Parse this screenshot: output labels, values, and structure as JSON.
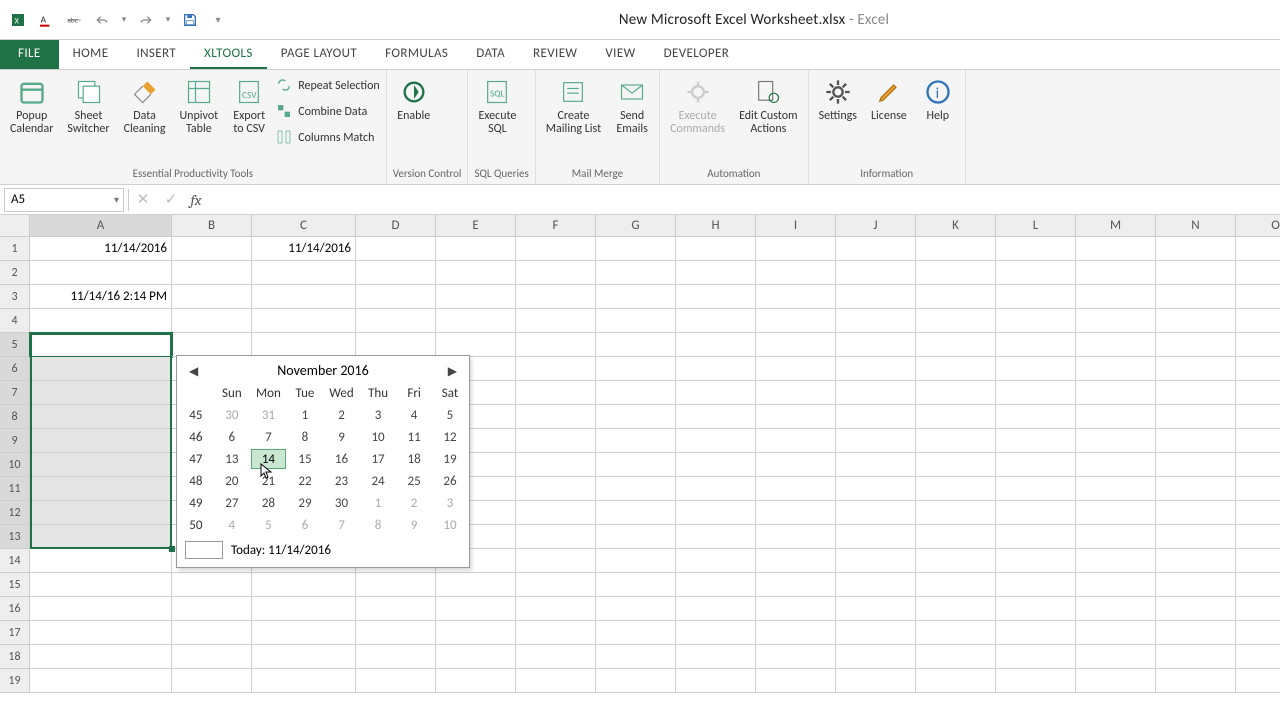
{
  "title": {
    "doc": "New Microsoft Excel Worksheet.xlsx",
    "app": "Excel"
  },
  "tabs": [
    "FILE",
    "HOME",
    "INSERT",
    "XLTools",
    "PAGE LAYOUT",
    "FORMULAS",
    "DATA",
    "REVIEW",
    "VIEW",
    "DEVELOPER"
  ],
  "activeTab": "XLTools",
  "ribbon": {
    "groups": [
      {
        "label": "Essential Productivity Tools",
        "big": [
          {
            "name": "popup-calendar-button",
            "label": "Popup\nCalendar",
            "icon": "calendar"
          },
          {
            "name": "sheet-switcher-button",
            "label": "Sheet\nSwitcher",
            "icon": "sheets"
          },
          {
            "name": "data-cleaning-button",
            "label": "Data\nCleaning",
            "icon": "broom"
          },
          {
            "name": "unpivot-table-button",
            "label": "Unpivot\nTable",
            "icon": "table"
          },
          {
            "name": "export-csv-button",
            "label": "Export\nto CSV",
            "icon": "csv"
          }
        ],
        "small": [
          {
            "name": "repeat-selection-button",
            "label": "Repeat Selection",
            "icon": "repeat"
          },
          {
            "name": "combine-data-button",
            "label": "Combine Data",
            "icon": "combine"
          },
          {
            "name": "columns-match-button",
            "label": "Columns Match",
            "icon": "match"
          }
        ]
      },
      {
        "label": "Version Control",
        "big": [
          {
            "name": "enable-button",
            "label": "Enable",
            "icon": "version"
          }
        ],
        "small": []
      },
      {
        "label": "SQL Queries",
        "big": [
          {
            "name": "execute-sql-button",
            "label": "Execute\nSQL",
            "icon": "sql"
          }
        ],
        "small": []
      },
      {
        "label": "Mail Merge",
        "big": [
          {
            "name": "create-mailing-list-button",
            "label": "Create\nMailing List",
            "icon": "list"
          },
          {
            "name": "send-emails-button",
            "label": "Send\nEmails",
            "icon": "mail"
          }
        ],
        "small": []
      },
      {
        "label": "Automation",
        "big": [
          {
            "name": "execute-commands-button",
            "label": "Execute\nCommands",
            "icon": "gear",
            "disabled": true
          },
          {
            "name": "edit-custom-actions-button",
            "label": "Edit Custom\nActions",
            "icon": "geardoc"
          }
        ],
        "small": []
      },
      {
        "label": "Information",
        "big": [
          {
            "name": "settings-button",
            "label": "Settings",
            "icon": "cog"
          },
          {
            "name": "license-button",
            "label": "License",
            "icon": "pen"
          },
          {
            "name": "help-button",
            "label": "Help",
            "icon": "info"
          }
        ],
        "small": []
      }
    ]
  },
  "namebox": "A5",
  "columns": [
    "A",
    "B",
    "C",
    "D",
    "E",
    "F",
    "G",
    "H",
    "I",
    "J",
    "K",
    "L",
    "M",
    "N",
    "O"
  ],
  "rows": 19,
  "cells": {
    "A1": "11/14/2016",
    "C1": "11/14/2016",
    "A3": "11/14/16 2:14 PM"
  },
  "selection": {
    "startRow": 5,
    "endRow": 13,
    "col": "A",
    "active": "A5"
  },
  "datepicker": {
    "month": "November 2016",
    "days": [
      "Sun",
      "Mon",
      "Tue",
      "Wed",
      "Thu",
      "Fri",
      "Sat"
    ],
    "weeks": [
      {
        "wk": 45,
        "d": [
          {
            "v": 30,
            "om": 1
          },
          {
            "v": 31,
            "om": 1
          },
          {
            "v": 1
          },
          {
            "v": 2
          },
          {
            "v": 3
          },
          {
            "v": 4
          },
          {
            "v": 5
          }
        ]
      },
      {
        "wk": 46,
        "d": [
          {
            "v": 6
          },
          {
            "v": 7
          },
          {
            "v": 8
          },
          {
            "v": 9
          },
          {
            "v": 10
          },
          {
            "v": 11
          },
          {
            "v": 12
          }
        ]
      },
      {
        "wk": 47,
        "d": [
          {
            "v": 13
          },
          {
            "v": 14,
            "today": 1
          },
          {
            "v": 15
          },
          {
            "v": 16
          },
          {
            "v": 17
          },
          {
            "v": 18
          },
          {
            "v": 19
          }
        ]
      },
      {
        "wk": 48,
        "d": [
          {
            "v": 20
          },
          {
            "v": 21
          },
          {
            "v": 22
          },
          {
            "v": 23
          },
          {
            "v": 24
          },
          {
            "v": 25
          },
          {
            "v": 26
          }
        ]
      },
      {
        "wk": 49,
        "d": [
          {
            "v": 27
          },
          {
            "v": 28
          },
          {
            "v": 29
          },
          {
            "v": 30
          },
          {
            "v": 1,
            "om": 1
          },
          {
            "v": 2,
            "om": 1
          },
          {
            "v": 3,
            "om": 1
          }
        ]
      },
      {
        "wk": 50,
        "d": [
          {
            "v": 4,
            "om": 1
          },
          {
            "v": 5,
            "om": 1
          },
          {
            "v": 6,
            "om": 1
          },
          {
            "v": 7,
            "om": 1
          },
          {
            "v": 8,
            "om": 1
          },
          {
            "v": 9,
            "om": 1
          },
          {
            "v": 10,
            "om": 1
          }
        ]
      }
    ],
    "today": "Today: 11/14/2016"
  }
}
